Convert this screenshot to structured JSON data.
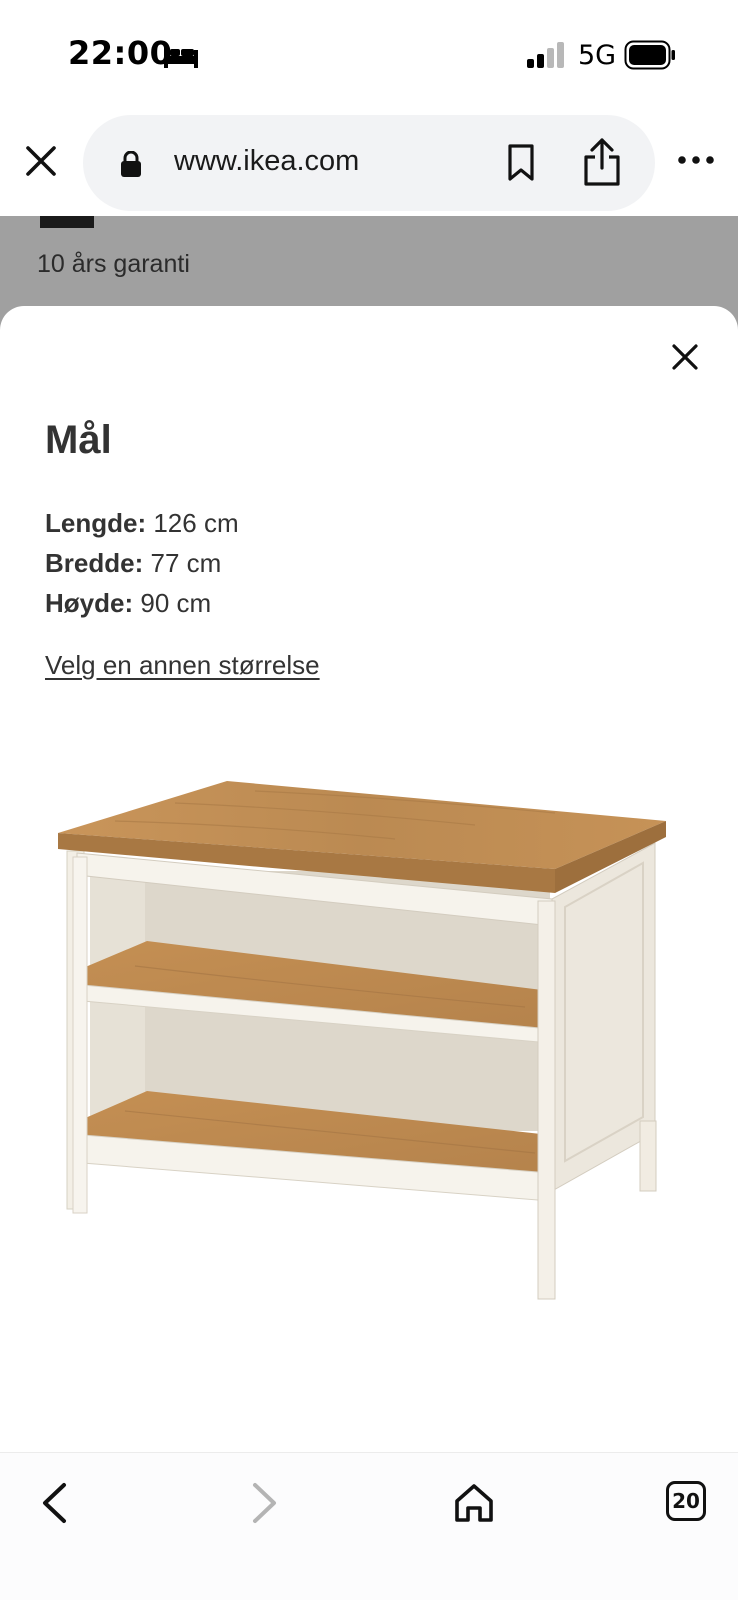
{
  "status_bar": {
    "time": "22:00",
    "network": "5G",
    "icons": [
      "bed-icon",
      "signal-icon",
      "battery-icon"
    ]
  },
  "browser": {
    "url": "www.ikea.com",
    "icons": [
      "close-icon",
      "lock-icon",
      "bookmark-icon",
      "share-icon",
      "more-icon"
    ]
  },
  "background_page": {
    "warranty_text": "10 års garanti"
  },
  "sheet": {
    "title": "Mål",
    "dimensions": [
      {
        "label": "Lengde:",
        "value": "126 cm"
      },
      {
        "label": "Bredde:",
        "value": "77 cm"
      },
      {
        "label": "Høyde:",
        "value": "90 cm"
      }
    ],
    "size_link": "Velg en annen størrelse",
    "image_subject": "kitchen island with oak top, white frame and two open shelves"
  },
  "bottom_bar": {
    "tab_count": "20",
    "icons": [
      "back-arrow-icon",
      "forward-arrow-icon",
      "home-icon",
      "tabs-icon"
    ]
  },
  "colors": {
    "scrim": "#a0a0a0",
    "url_pill": "#f2f3f5",
    "text": "#333333",
    "oak": "#c08a4e",
    "frame": "#f1ece2"
  }
}
